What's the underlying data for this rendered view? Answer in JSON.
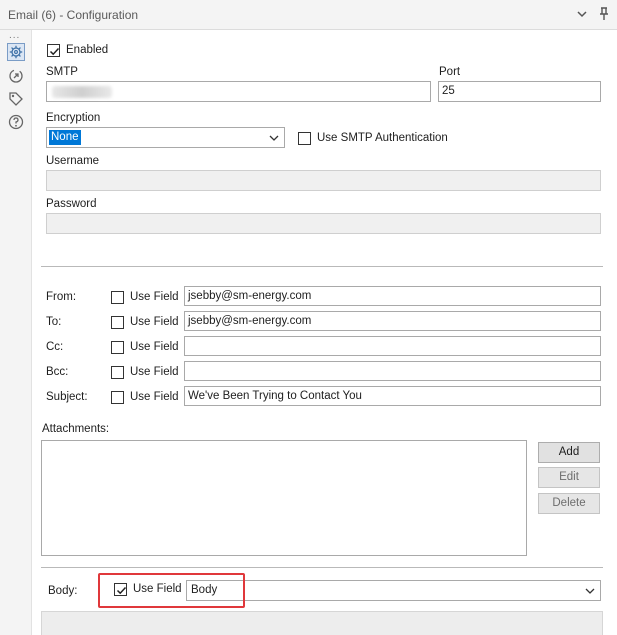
{
  "window": {
    "title": "Email (6) - Configuration"
  },
  "sidebar": {
    "dots": "...",
    "items": [
      "gear-icon",
      "connection-icon",
      "tag-icon",
      "help-icon"
    ]
  },
  "settings": {
    "enabled_label": "Enabled",
    "enabled_checked": true,
    "smtp_label": "SMTP",
    "smtp_value": "",
    "port_label": "Port",
    "port_value": "25",
    "encryption_label": "Encryption",
    "encryption_value": "None",
    "smtp_auth_label": "Use SMTP Authentication",
    "smtp_auth_checked": false,
    "username_label": "Username",
    "username_value": "",
    "password_label": "Password",
    "password_value": ""
  },
  "recipients": [
    {
      "label": "From:",
      "use_field_label": "Use Field",
      "checked": false,
      "value": "jsebby@sm-energy.com"
    },
    {
      "label": "To:",
      "use_field_label": "Use Field",
      "checked": false,
      "value": "jsebby@sm-energy.com"
    },
    {
      "label": "Cc:",
      "use_field_label": "Use Field",
      "checked": false,
      "value": ""
    },
    {
      "label": "Bcc:",
      "use_field_label": "Use Field",
      "checked": false,
      "value": ""
    },
    {
      "label": "Subject:",
      "use_field_label": "Use Field",
      "checked": false,
      "value": "We've Been Trying to Contact You"
    }
  ],
  "attachments": {
    "label": "Attachments:",
    "add_label": "Add",
    "edit_label": "Edit",
    "delete_label": "Delete"
  },
  "body": {
    "label": "Body:",
    "use_field_label": "Use Field",
    "use_field_checked": true,
    "field_value": "Body"
  },
  "colors": {
    "highlight": "#e0383b",
    "selection": "#0078d7"
  }
}
